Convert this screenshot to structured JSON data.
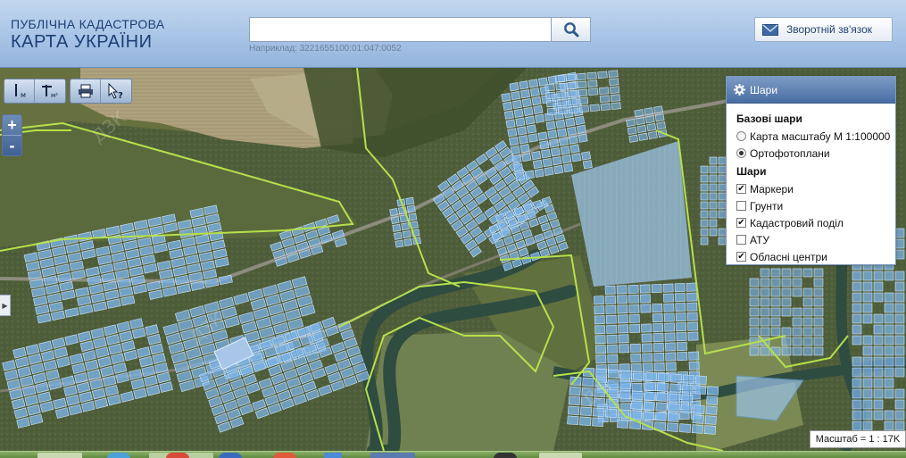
{
  "header": {
    "brand_line1": "ПУБЛІЧНА КАДАСТРОВА",
    "brand_line2": "КАРТА УКРАЇНИ",
    "search_value": "",
    "search_hint": "Наприклад: 3221655100:01:047:0052",
    "feedback_label": "Зворотній зв'язок"
  },
  "tools": [
    {
      "name": "measure-distance-tool",
      "label": "I",
      "sub": "м"
    },
    {
      "name": "measure-area-tool",
      "label": "†",
      "sub": "м²"
    },
    {
      "name": "print-tool",
      "label": "print-icon"
    },
    {
      "name": "identify-tool",
      "label": "cursor-question-icon"
    }
  ],
  "zoom": {
    "in": "+",
    "out": "-"
  },
  "layers": {
    "title": "Шари",
    "base_title": "Базові шари",
    "base": [
      {
        "label": "Карта масштабу М 1:100000",
        "selected": false
      },
      {
        "label": "Ортофотоплани",
        "selected": true
      }
    ],
    "overlay_title": "Шари",
    "overlays": [
      {
        "label": "Маркери",
        "checked": true
      },
      {
        "label": "Грунти",
        "checked": false
      },
      {
        "label": "Кадастровий поділ",
        "checked": true
      },
      {
        "label": "АТУ",
        "checked": false
      },
      {
        "label": "Обласні центри",
        "checked": true
      }
    ]
  },
  "scale_label": "Масштаб = 1 : 17K",
  "colors": {
    "header_text": "#1c3f77",
    "parcel_fill": "#7fb8f0",
    "boundary": "#b6e04a",
    "river": "#3c5a4a"
  }
}
